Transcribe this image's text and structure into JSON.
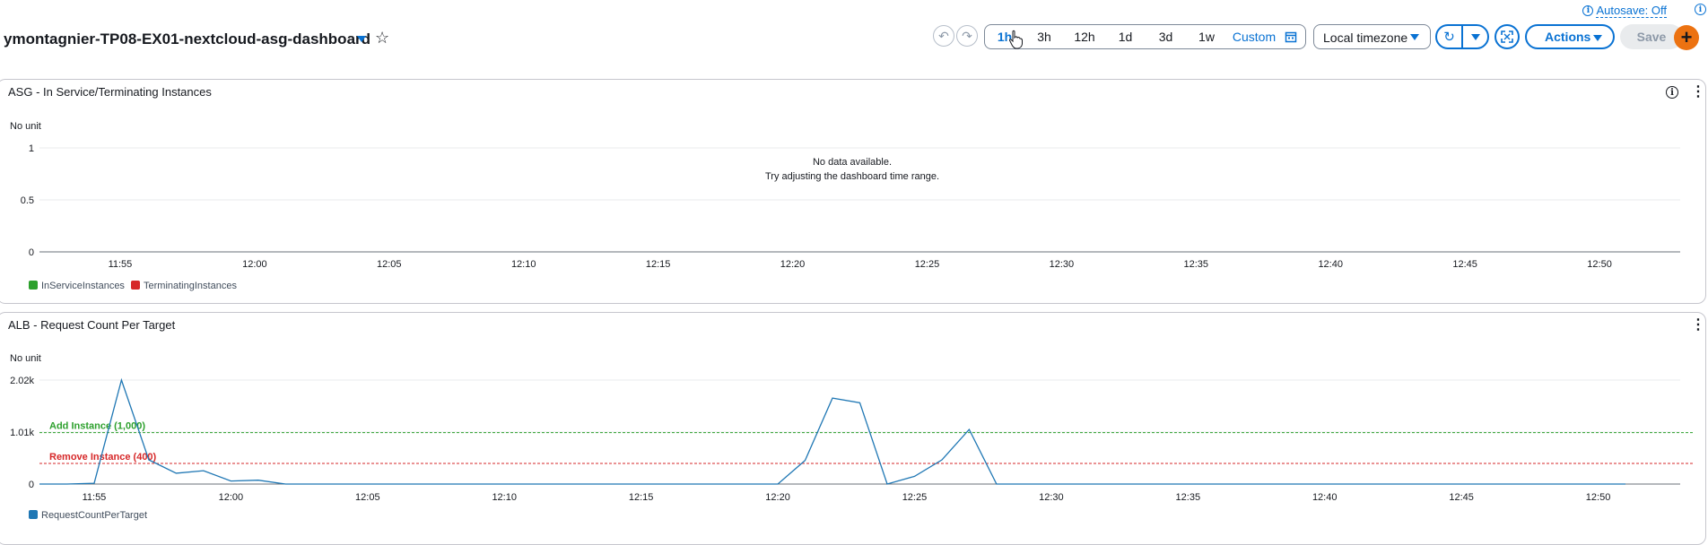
{
  "header": {
    "title": "ymontagnier-TP08-EX01-nextcloud-asg-dashboard",
    "autosave": "Autosave: Off",
    "undo_icon": "undo-icon",
    "redo_icon": "redo-icon",
    "time_ranges": [
      {
        "label": "1h",
        "active": true
      },
      {
        "label": "3h",
        "active": false
      },
      {
        "label": "12h",
        "active": false
      },
      {
        "label": "1d",
        "active": false
      },
      {
        "label": "3d",
        "active": false
      },
      {
        "label": "1w",
        "active": false
      }
    ],
    "custom_label": "Custom",
    "timezone": "Local timezone",
    "actions_label": "Actions",
    "save_label": "Save",
    "add_label": "+"
  },
  "colors": {
    "accent": "#0972d3",
    "add_button": "#ec7211",
    "in_service": "#2ca02c",
    "terminating": "#d62728",
    "request_count": "#1f77b4"
  },
  "widgets": [
    {
      "title": "ASG - In Service/Terminating Instances",
      "unit": "No unit",
      "no_data": "No data available.",
      "no_data_hint": "Try adjusting the dashboard time range.",
      "legend": [
        "InServiceInstances",
        "TerminatingInstances"
      ]
    },
    {
      "title": "ALB - Request Count Per Target",
      "unit": "No unit",
      "legend": [
        "RequestCountPerTarget"
      ],
      "annotations": [
        "Add Instance (1,000)",
        "Remove Instance (400)"
      ]
    }
  ],
  "chart_data": [
    {
      "type": "line",
      "title": "ASG - In Service/Terminating Instances",
      "ylabel": "No unit",
      "y_ticks": [
        "0",
        "0.5",
        "1"
      ],
      "ylim": [
        0,
        1
      ],
      "x_ticks": [
        "11:55",
        "12:00",
        "12:05",
        "12:10",
        "12:15",
        "12:20",
        "12:25",
        "12:30",
        "12:35",
        "12:40",
        "12:45",
        "12:50"
      ],
      "series": [
        {
          "name": "InServiceInstances",
          "values": []
        },
        {
          "name": "TerminatingInstances",
          "values": []
        }
      ],
      "legend_position": "bottom-left"
    },
    {
      "type": "line",
      "title": "ALB - Request Count Per Target",
      "ylabel": "No unit",
      "y_ticks": [
        "0",
        "1.01k",
        "2.02k"
      ],
      "ylim": [
        0,
        2020
      ],
      "x_ticks": [
        "11:55",
        "12:00",
        "12:05",
        "12:10",
        "12:15",
        "12:20",
        "12:25",
        "12:30",
        "12:35",
        "12:40",
        "12:45",
        "12:50"
      ],
      "series": [
        {
          "name": "RequestCountPerTarget",
          "x": [
            "11:53",
            "11:54",
            "11:55",
            "11:56",
            "11:57",
            "11:58",
            "11:59",
            "12:00",
            "12:01",
            "12:02",
            "12:03",
            "12:04",
            "12:05",
            "12:06",
            "12:07",
            "12:08",
            "12:09",
            "12:10",
            "12:11",
            "12:12",
            "12:13",
            "12:14",
            "12:15",
            "12:16",
            "12:17",
            "12:18",
            "12:19",
            "12:20",
            "12:21",
            "12:22",
            "12:23",
            "12:24",
            "12:25",
            "12:26",
            "12:27",
            "12:28",
            "12:29",
            "12:30",
            "12:31",
            "12:32",
            "12:33",
            "12:34",
            "12:35",
            "12:36",
            "12:37",
            "12:38",
            "12:39",
            "12:40",
            "12:41",
            "12:42",
            "12:43",
            "12:44",
            "12:45",
            "12:46",
            "12:47",
            "12:48",
            "12:49",
            "12:50",
            "12:51"
          ],
          "values": [
            0,
            0,
            15,
            2020,
            470,
            210,
            260,
            60,
            75,
            0,
            0,
            0,
            0,
            0,
            0,
            0,
            0,
            0,
            0,
            0,
            0,
            0,
            0,
            0,
            0,
            0,
            0,
            0,
            460,
            1670,
            1580,
            0,
            150,
            470,
            1060,
            0,
            0,
            0,
            0,
            0,
            0,
            0,
            0,
            0,
            0,
            0,
            0,
            0,
            0,
            0,
            0,
            0,
            0,
            0,
            0,
            0,
            0,
            0,
            0
          ]
        }
      ],
      "thresholds": [
        {
          "label": "Add Instance (1,000)",
          "value": 1000
        },
        {
          "label": "Remove Instance (400)",
          "value": 400
        }
      ],
      "legend_position": "bottom-left"
    }
  ]
}
